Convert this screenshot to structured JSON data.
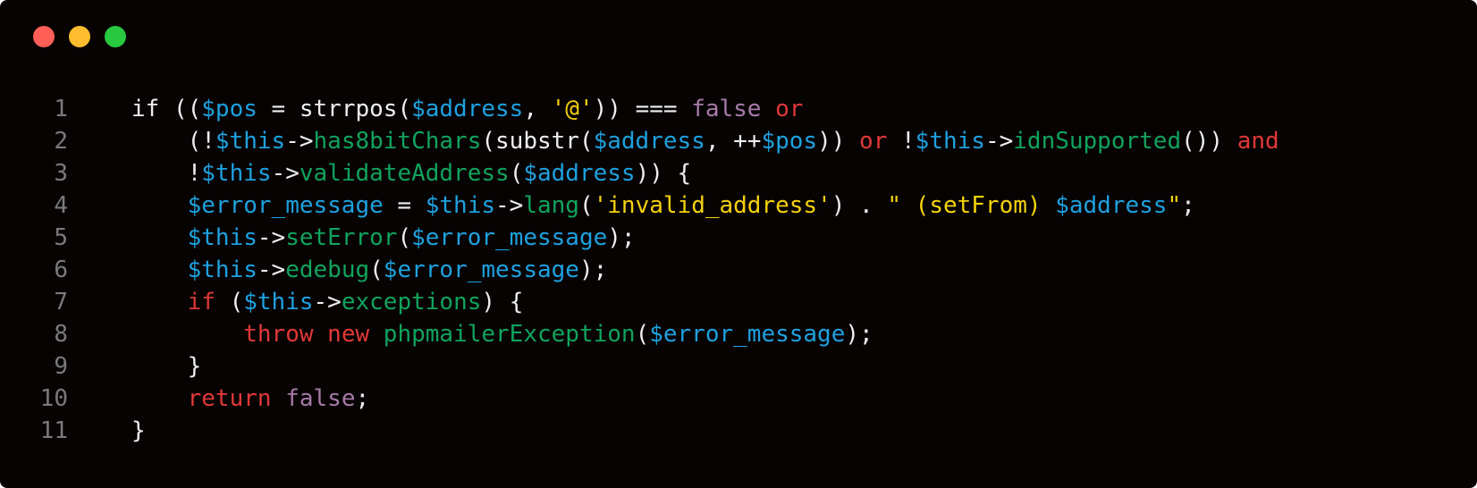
{
  "window": {
    "controls": [
      {
        "name": "close",
        "color": "#ff5f57"
      },
      {
        "name": "minimize",
        "color": "#febc2e"
      },
      {
        "name": "maximize",
        "color": "#28c840"
      }
    ]
  },
  "code": {
    "language": "php",
    "colors": {
      "background": "#070303",
      "line_number": "#7a7a7a",
      "plain": "#eeeeee",
      "keyword": "#e03838",
      "variable": "#1ea1df",
      "string": "#f5d20c",
      "constant": "#a77aa8",
      "function": "#10a35d"
    },
    "lines": [
      {
        "number": "1",
        "tokens": [
          {
            "t": "plain",
            "v": "if"
          },
          {
            "t": "plain",
            "v": " (("
          },
          {
            "t": "variable",
            "v": "$pos"
          },
          {
            "t": "plain",
            "v": " = strrpos("
          },
          {
            "t": "variable",
            "v": "$address"
          },
          {
            "t": "plain",
            "v": ", "
          },
          {
            "t": "string",
            "v": "'@'"
          },
          {
            "t": "plain",
            "v": ")) === "
          },
          {
            "t": "constant",
            "v": "false"
          },
          {
            "t": "plain",
            "v": " "
          },
          {
            "t": "keyword",
            "v": "or"
          }
        ]
      },
      {
        "number": "2",
        "tokens": [
          {
            "t": "plain",
            "v": "    (!"
          },
          {
            "t": "variable",
            "v": "$this"
          },
          {
            "t": "plain",
            "v": "->"
          },
          {
            "t": "function",
            "v": "has8bitChars"
          },
          {
            "t": "plain",
            "v": "(substr("
          },
          {
            "t": "variable",
            "v": "$address"
          },
          {
            "t": "plain",
            "v": ", ++"
          },
          {
            "t": "variable",
            "v": "$pos"
          },
          {
            "t": "plain",
            "v": ")) "
          },
          {
            "t": "keyword",
            "v": "or"
          },
          {
            "t": "plain",
            "v": " !"
          },
          {
            "t": "variable",
            "v": "$this"
          },
          {
            "t": "plain",
            "v": "->"
          },
          {
            "t": "function",
            "v": "idnSupported"
          },
          {
            "t": "plain",
            "v": "()) "
          },
          {
            "t": "keyword",
            "v": "and"
          }
        ]
      },
      {
        "number": "3",
        "tokens": [
          {
            "t": "plain",
            "v": "    !"
          },
          {
            "t": "variable",
            "v": "$this"
          },
          {
            "t": "plain",
            "v": "->"
          },
          {
            "t": "function",
            "v": "validateAddress"
          },
          {
            "t": "plain",
            "v": "("
          },
          {
            "t": "variable",
            "v": "$address"
          },
          {
            "t": "plain",
            "v": ")) {"
          }
        ]
      },
      {
        "number": "4",
        "tokens": [
          {
            "t": "plain",
            "v": "    "
          },
          {
            "t": "variable",
            "v": "$error_message"
          },
          {
            "t": "plain",
            "v": " = "
          },
          {
            "t": "variable",
            "v": "$this"
          },
          {
            "t": "plain",
            "v": "->"
          },
          {
            "t": "function",
            "v": "lang"
          },
          {
            "t": "plain",
            "v": "("
          },
          {
            "t": "string",
            "v": "'invalid_address'"
          },
          {
            "t": "plain",
            "v": ") . "
          },
          {
            "t": "string",
            "v": "\" (setFrom) "
          },
          {
            "t": "variable",
            "v": "$address"
          },
          {
            "t": "string",
            "v": "\""
          },
          {
            "t": "plain",
            "v": ";"
          }
        ]
      },
      {
        "number": "5",
        "tokens": [
          {
            "t": "plain",
            "v": "    "
          },
          {
            "t": "variable",
            "v": "$this"
          },
          {
            "t": "plain",
            "v": "->"
          },
          {
            "t": "function",
            "v": "setError"
          },
          {
            "t": "plain",
            "v": "("
          },
          {
            "t": "variable",
            "v": "$error_message"
          },
          {
            "t": "plain",
            "v": ");"
          }
        ]
      },
      {
        "number": "6",
        "tokens": [
          {
            "t": "plain",
            "v": "    "
          },
          {
            "t": "variable",
            "v": "$this"
          },
          {
            "t": "plain",
            "v": "->"
          },
          {
            "t": "function",
            "v": "edebug"
          },
          {
            "t": "plain",
            "v": "("
          },
          {
            "t": "variable",
            "v": "$error_message"
          },
          {
            "t": "plain",
            "v": ");"
          }
        ]
      },
      {
        "number": "7",
        "tokens": [
          {
            "t": "plain",
            "v": "    "
          },
          {
            "t": "keyword",
            "v": "if"
          },
          {
            "t": "plain",
            "v": " ("
          },
          {
            "t": "variable",
            "v": "$this"
          },
          {
            "t": "plain",
            "v": "->"
          },
          {
            "t": "function",
            "v": "exceptions"
          },
          {
            "t": "plain",
            "v": ") {"
          }
        ]
      },
      {
        "number": "8",
        "tokens": [
          {
            "t": "plain",
            "v": "        "
          },
          {
            "t": "keyword",
            "v": "throw"
          },
          {
            "t": "plain",
            "v": " "
          },
          {
            "t": "keyword",
            "v": "new"
          },
          {
            "t": "plain",
            "v": " "
          },
          {
            "t": "function",
            "v": "phpmailerException"
          },
          {
            "t": "plain",
            "v": "("
          },
          {
            "t": "variable",
            "v": "$error_message"
          },
          {
            "t": "plain",
            "v": ");"
          }
        ]
      },
      {
        "number": "9",
        "tokens": [
          {
            "t": "plain",
            "v": "    }"
          }
        ]
      },
      {
        "number": "10",
        "tokens": [
          {
            "t": "plain",
            "v": "    "
          },
          {
            "t": "keyword",
            "v": "return"
          },
          {
            "t": "plain",
            "v": " "
          },
          {
            "t": "constant",
            "v": "false"
          },
          {
            "t": "plain",
            "v": ";"
          }
        ]
      },
      {
        "number": "11",
        "tokens": [
          {
            "t": "plain",
            "v": "}"
          }
        ]
      }
    ]
  }
}
